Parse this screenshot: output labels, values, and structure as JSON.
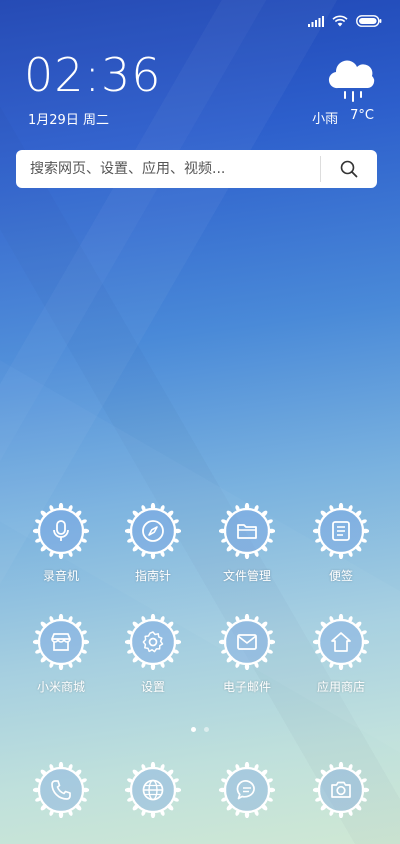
{
  "status_bar": {
    "signal": "signal-icon",
    "wifi": "wifi-icon",
    "battery": "battery-icon"
  },
  "clock": {
    "time": "02:36",
    "date": "1月29日 周二"
  },
  "weather": {
    "icon": "rain-cloud-icon",
    "condition": "小雨",
    "temperature": "7°C"
  },
  "search": {
    "placeholder": "搜索网页、设置、应用、视频..."
  },
  "apps_row1": [
    {
      "label": "录音机",
      "icon": "microphone-icon"
    },
    {
      "label": "指南针",
      "icon": "compass-icon"
    },
    {
      "label": "文件管理",
      "icon": "folder-icon"
    },
    {
      "label": "便签",
      "icon": "notes-icon"
    }
  ],
  "apps_row2": [
    {
      "label": "小米商城",
      "icon": "store-icon"
    },
    {
      "label": "设置",
      "icon": "gear-icon"
    },
    {
      "label": "电子邮件",
      "icon": "mail-icon"
    },
    {
      "label": "应用商店",
      "icon": "home-store-icon"
    }
  ],
  "dock": [
    {
      "icon": "phone-icon"
    },
    {
      "icon": "browser-icon"
    },
    {
      "icon": "message-icon"
    },
    {
      "icon": "camera-icon"
    }
  ],
  "pager": {
    "pages": 2,
    "active": 1
  }
}
